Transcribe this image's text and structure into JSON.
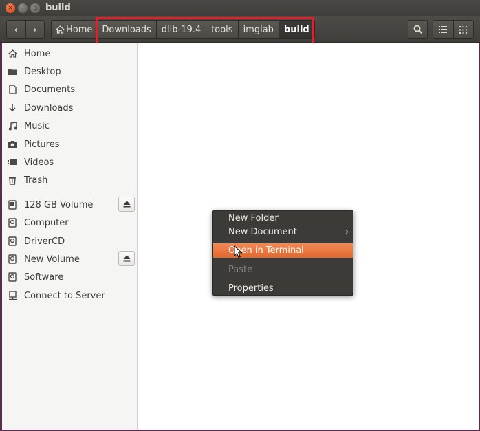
{
  "window": {
    "title": "build",
    "close_glyph": "×",
    "min_glyph": "–",
    "max_glyph": "▫"
  },
  "nav": {
    "back_glyph": "‹",
    "forward_glyph": "›"
  },
  "breadcrumb": {
    "home_label": "Home",
    "home_icon": "home-icon",
    "items": [
      "Downloads",
      "dlib-19.4",
      "tools",
      "imglab",
      "build"
    ]
  },
  "toolbar": {
    "search_icon": "search-icon",
    "list_view_icon": "list-view-icon",
    "grid_view_icon": "grid-view-icon"
  },
  "sidebar": {
    "places": [
      {
        "label": "Home",
        "icon": "home-icon"
      },
      {
        "label": "Desktop",
        "icon": "desktop-folder-icon"
      },
      {
        "label": "Documents",
        "icon": "document-icon"
      },
      {
        "label": "Downloads",
        "icon": "download-icon"
      },
      {
        "label": "Music",
        "icon": "music-icon"
      },
      {
        "label": "Pictures",
        "icon": "camera-icon"
      },
      {
        "label": "Videos",
        "icon": "video-icon"
      },
      {
        "label": "Trash",
        "icon": "trash-icon"
      }
    ],
    "devices": [
      {
        "label": "128 GB Volume",
        "icon": "drive-icon",
        "eject": true
      },
      {
        "label": "Computer",
        "icon": "disk-icon",
        "eject": false
      },
      {
        "label": "DriverCD",
        "icon": "disk-icon",
        "eject": false
      },
      {
        "label": "New Volume",
        "icon": "disk-icon",
        "eject": true
      },
      {
        "label": "Software",
        "icon": "disk-icon",
        "eject": false
      },
      {
        "label": "Connect to Server",
        "icon": "network-server-icon",
        "eject": false
      }
    ]
  },
  "context_menu": {
    "items": [
      {
        "label": "New Folder",
        "state": "normal"
      },
      {
        "label": "New Document",
        "state": "normal",
        "submenu": true
      },
      {
        "label": "Open in Terminal",
        "state": "hover"
      },
      {
        "label": "Paste",
        "state": "disabled"
      },
      {
        "label": "Properties",
        "state": "normal"
      }
    ]
  },
  "colors": {
    "accent": "#e2672b",
    "highlight_box": "#e41e2c",
    "headerbar": "#3f3e3a",
    "sidebar_bg": "#f5f5f4"
  }
}
